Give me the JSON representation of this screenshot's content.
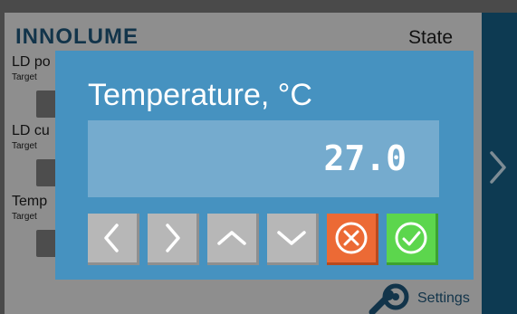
{
  "header": {
    "brand": "INNOLUME",
    "state_label": "State"
  },
  "params": [
    {
      "label": "LD po",
      "sub": "Target"
    },
    {
      "label": "LD cu",
      "sub": "Target"
    },
    {
      "label": "Temp",
      "sub": "Target"
    }
  ],
  "footer": {
    "settings_label": "Settings"
  },
  "dialog": {
    "title": "Temperature, °C",
    "value": "27.0",
    "buttons": [
      {
        "icon": "chevron-left-icon"
      },
      {
        "icon": "chevron-right-icon"
      },
      {
        "icon": "chevron-up-icon"
      },
      {
        "icon": "chevron-down-icon"
      },
      {
        "icon": "cancel-icon",
        "color": "#ec6a35"
      },
      {
        "icon": "confirm-icon",
        "color": "#5cd64d"
      }
    ]
  },
  "colors": {
    "brand": "#12344a",
    "dialog_bg": "#4692c0",
    "value_bg": "#75abce",
    "panel": "#0d3a52"
  }
}
